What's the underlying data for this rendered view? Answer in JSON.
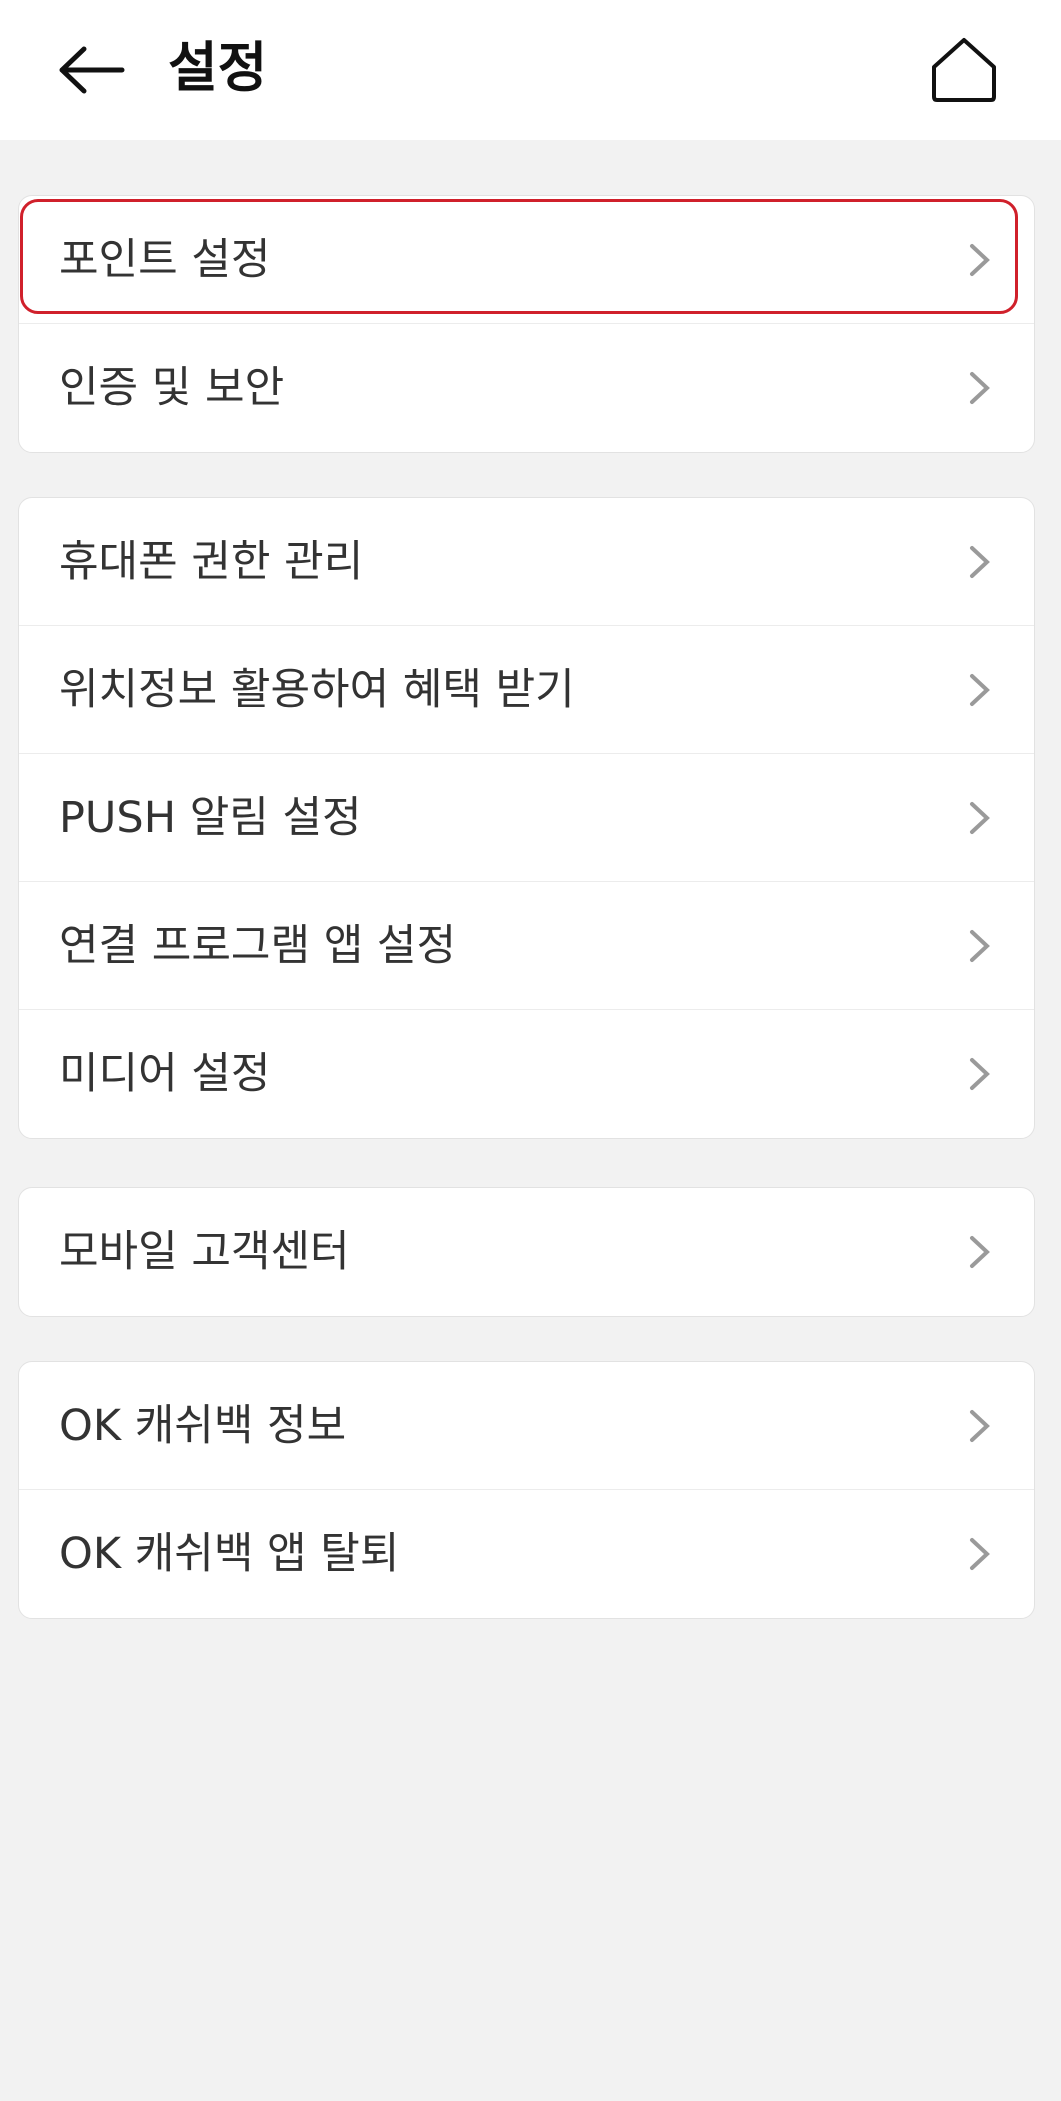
{
  "header": {
    "title": "설정",
    "back_icon": "back-arrow-icon",
    "home_icon": "home-icon"
  },
  "colors": {
    "highlight": "#d0202b",
    "background": "#f2f2f2",
    "card": "#ffffff",
    "chevron": "#9a9a9a"
  },
  "groups": [
    {
      "items": [
        {
          "label": "포인트 설정",
          "highlighted": true
        },
        {
          "label": "인증 및 보안"
        }
      ]
    },
    {
      "items": [
        {
          "label": "휴대폰 권한 관리"
        },
        {
          "label": "위치정보 활용하여 혜택 받기"
        },
        {
          "label": "PUSH 알림 설정"
        },
        {
          "label": "연결 프로그램 앱 설정"
        },
        {
          "label": "미디어 설정"
        }
      ]
    },
    {
      "items": [
        {
          "label": "모바일 고객센터"
        }
      ]
    },
    {
      "items": [
        {
          "label": "OK 캐쉬백 정보"
        },
        {
          "label": "OK 캐쉬백 앱 탈퇴"
        }
      ]
    }
  ]
}
